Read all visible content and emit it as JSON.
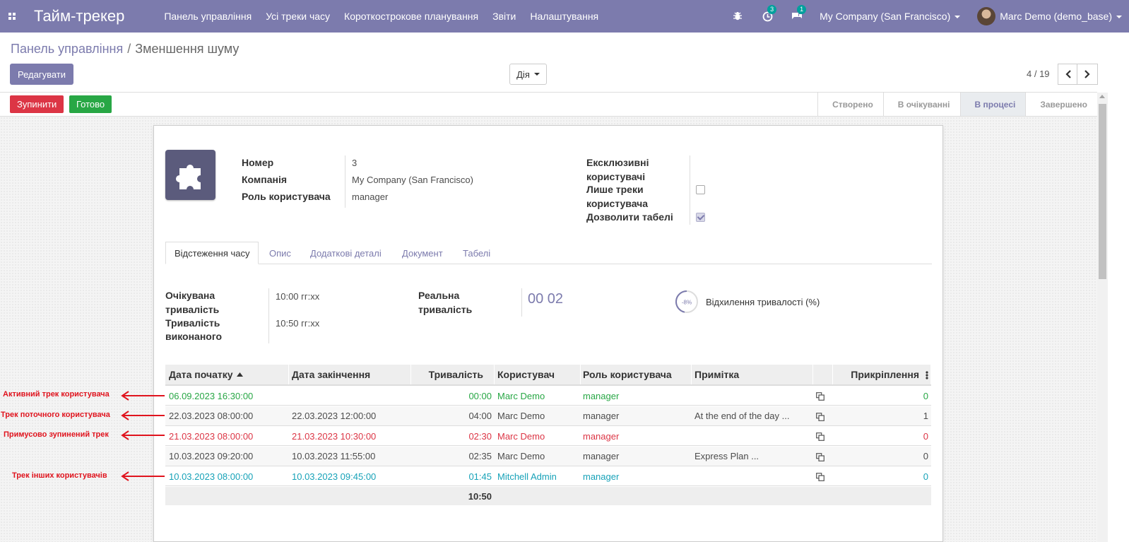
{
  "navbar": {
    "brand": "Тайм-трекер",
    "menu": [
      "Панель управління",
      "Усі треки часу",
      "Короткострокове планування",
      "Звіти",
      "Налаштування"
    ],
    "activity_count": "3",
    "messages_count": "1",
    "company": "My Company (San Francisco)",
    "user": "Marc Demo (demo_base)",
    "colors": {
      "navbar": "#7c7bad",
      "badge": "#00a09d"
    }
  },
  "breadcrumb": {
    "parent": "Панель управління",
    "separator": "/",
    "current": "Зменшення шуму"
  },
  "control": {
    "edit_label": "Редагувати",
    "action_label": "Дія",
    "pager": "4 / 19"
  },
  "statusbar": {
    "stop_label": "Зупинити",
    "done_label": "Готово",
    "stages": [
      "Створено",
      "В очікуванні",
      "В процесі",
      "Завершено"
    ],
    "active_stage": "В процесі"
  },
  "form": {
    "number_label": "Номер",
    "number_value": "3",
    "company_label": "Компанія",
    "company_value": "My Company (San Francisco)",
    "role_label": "Роль користувача",
    "role_value": "manager",
    "exclusive_label_1": "Ексклюзивні",
    "exclusive_label_2": "користувачі",
    "own_tracks_label_1": "Лише треки",
    "own_tracks_label_2": "користувача",
    "own_tracks_checked": false,
    "allow_timesheet_label": "Дозволити табелі",
    "allow_timesheet_checked": true
  },
  "tabs": [
    "Відстеження часу",
    "Опис",
    "Додаткові деталі",
    "Документ",
    "Табелі"
  ],
  "tracking": {
    "expected_label_1": "Очікувана",
    "expected_label_2": "тривалість",
    "expected_value": "10:00 гг:хх",
    "done_label_1": "Тривалість",
    "done_label_2": "виконаного",
    "done_value": "10:50 гг:хх",
    "real_label_1": "Реальна",
    "real_label_2": "тривалість",
    "real_value": "00 02",
    "deviation_value": "-8%",
    "deviation_label": "Відхилення тривалості (%)"
  },
  "table": {
    "columns": [
      "Дата початку",
      "Дата закінчення",
      "Тривалість",
      "Користувач",
      "Роль користувача",
      "Примітка",
      "",
      "Прикріплення"
    ],
    "rows": [
      {
        "start": "06.09.2023 16:30:00",
        "end": "",
        "duration": "00:00",
        "user": "Marc Demo",
        "role": "manager",
        "note": "",
        "attachments": "0",
        "style": "green"
      },
      {
        "start": "22.03.2023 08:00:00",
        "end": "22.03.2023 12:00:00",
        "duration": "04:00",
        "user": "Marc Demo",
        "role": "manager",
        "note": "At the end of the day ...",
        "attachments": "1",
        "style": "plain"
      },
      {
        "start": "21.03.2023 08:00:00",
        "end": "21.03.2023 10:30:00",
        "duration": "02:30",
        "user": "Marc Demo",
        "role": "manager",
        "note": "",
        "attachments": "0",
        "style": "red"
      },
      {
        "start": "10.03.2023 09:20:00",
        "end": "10.03.2023 11:55:00",
        "duration": "02:35",
        "user": "Marc Demo",
        "role": "manager",
        "note": "Express Plan ...",
        "attachments": "0",
        "style": "plain"
      },
      {
        "start": "10.03.2023 08:00:00",
        "end": "10.03.2023 09:45:00",
        "duration": "01:45",
        "user": "Mitchell Admin",
        "role": "manager",
        "note": "",
        "attachments": "0",
        "style": "blue"
      }
    ],
    "total_duration": "10:50"
  },
  "annotations": [
    "Активний трек користувача",
    "Трек поточного користувача",
    "Примусово зупинений трек",
    "Трек інших користувачів"
  ]
}
